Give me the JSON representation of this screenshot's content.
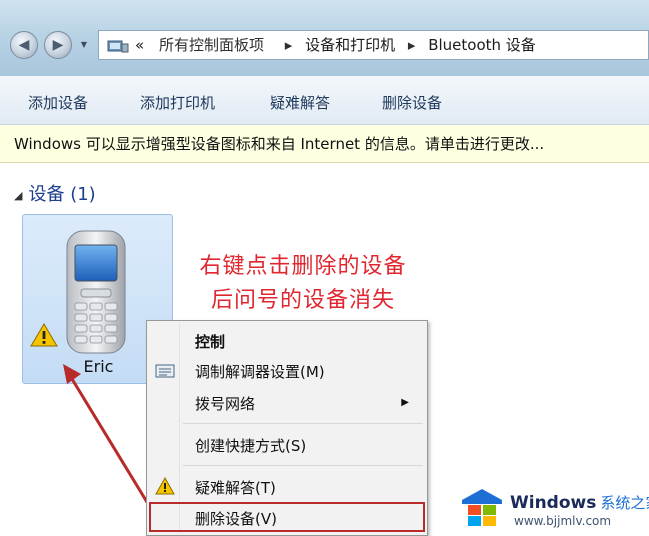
{
  "address": {
    "overflow": "«",
    "crumbs": [
      "所有控制面板项",
      "设备和打印机",
      "Bluetooth 设备"
    ]
  },
  "toolbar": {
    "add_device": "添加设备",
    "add_printer": "添加打印机",
    "troubleshoot": "疑难解答",
    "remove_device": "删除设备"
  },
  "infobar": {
    "text": "Windows 可以显示增强型设备图标和来自 Internet 的信息。请单击进行更改..."
  },
  "group": {
    "title": "设备 (1)"
  },
  "device": {
    "name": "Eric"
  },
  "annotation": {
    "line1": "右键点击删除的设备",
    "line2": "后问号的设备消失"
  },
  "context_menu": {
    "items": [
      {
        "label": "控制",
        "bold": true
      },
      {
        "label": "调制解调器设置(M)",
        "icon": "modem-icon"
      },
      {
        "label": "拨号网络",
        "submenu": true
      },
      {
        "label": "创建快捷方式(S)"
      },
      {
        "label": "疑难解答(T)",
        "icon": "warning-icon"
      },
      {
        "label": "删除设备(V)",
        "highlighted": true
      }
    ]
  },
  "watermark": {
    "brand": "Windows",
    "brand_suffix": "系统之家",
    "url": "www.bjjmlv.com"
  },
  "colors": {
    "annotation": "#e0262e",
    "highlight_box": "#b72b2b",
    "info_bar": "#ffffe1",
    "toolbar_text": "#1e395b"
  }
}
